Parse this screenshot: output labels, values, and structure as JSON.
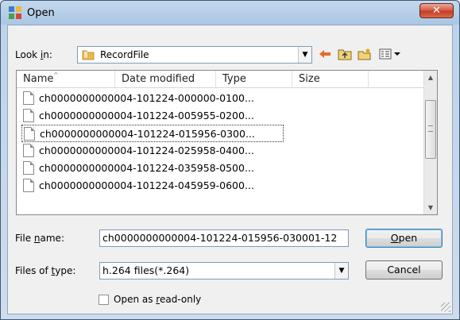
{
  "window": {
    "title": "Open",
    "close_glyph": "✕"
  },
  "lookin": {
    "label_prefix": "Look ",
    "label_ul": "i",
    "label_suffix": "n:",
    "value": "RecordFile"
  },
  "toolbar": {
    "back_icon": "back-arrow-icon",
    "up_icon": "up-folder-icon",
    "new_folder_icon": "new-folder-icon",
    "view_icon": "view-menu-icon"
  },
  "columns": [
    "Name",
    "Date modified",
    "Type",
    "Size"
  ],
  "files": [
    "ch0000000000004-101224-000000-0100...",
    "ch0000000000004-101224-005955-0200...",
    "ch0000000000004-101224-015956-0300...",
    "ch0000000000004-101224-025958-0400...",
    "ch0000000000004-101224-035958-0500...",
    "ch0000000000004-101224-045959-0600..."
  ],
  "filename": {
    "label_prefix": "File ",
    "label_ul": "n",
    "label_suffix": "ame:",
    "value": "ch0000000000004-101224-015956-030001-12"
  },
  "filetype": {
    "label_prefix": "Files of ",
    "label_ul": "t",
    "label_suffix": "ype:",
    "value": "h.264 files(*.264)"
  },
  "buttons": {
    "open_ul": "O",
    "open_rest": "pen",
    "cancel": "Cancel"
  },
  "readonly": {
    "label_prefix": "Open as ",
    "label_ul": "r",
    "label_suffix": "ead-only"
  }
}
